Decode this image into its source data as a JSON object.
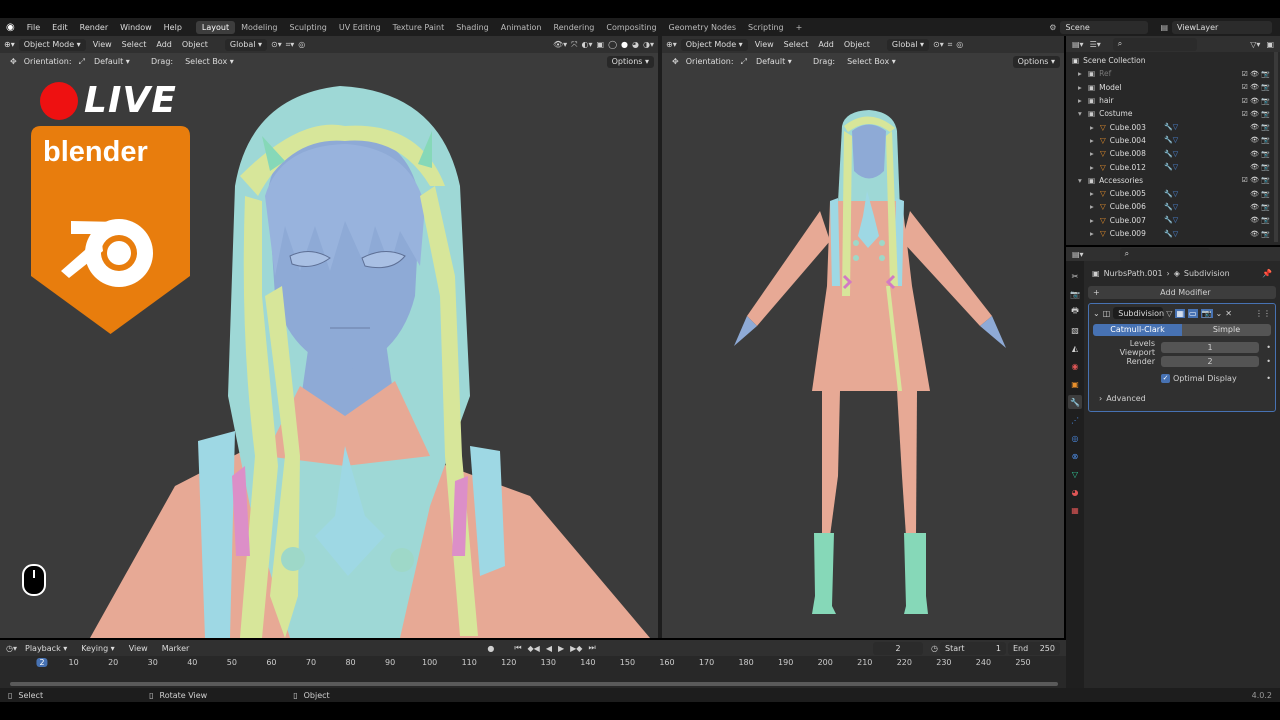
{
  "top_menu": [
    "File",
    "Edit",
    "Render",
    "Window",
    "Help"
  ],
  "workspaces": [
    {
      "label": "Layout",
      "active": true
    },
    {
      "label": "Modeling",
      "active": false
    },
    {
      "label": "Sculpting",
      "active": false
    },
    {
      "label": "UV Editing",
      "active": false
    },
    {
      "label": "Texture Paint",
      "active": false
    },
    {
      "label": "Shading",
      "active": false
    },
    {
      "label": "Animation",
      "active": false
    },
    {
      "label": "Rendering",
      "active": false
    },
    {
      "label": "Compositing",
      "active": false
    },
    {
      "label": "Geometry Nodes",
      "active": false
    },
    {
      "label": "Scripting",
      "active": false
    }
  ],
  "scene": "Scene",
  "view_layer": "ViewLayer",
  "viewport": {
    "mode": "Object Mode",
    "menus": [
      "View",
      "Select",
      "Add",
      "Object"
    ],
    "transform": "Global",
    "orientation_label": "Orientation:",
    "orientation_value": "Default",
    "drag_label": "Drag:",
    "drag_value": "Select Box",
    "options": "Options"
  },
  "overlay": {
    "live": "LIVE",
    "blender": "blender"
  },
  "outliner": {
    "root": "Scene Collection",
    "items": [
      {
        "label": "Ref",
        "indent": 0,
        "type": "collection",
        "dim": true
      },
      {
        "label": "Model",
        "indent": 0,
        "type": "collection"
      },
      {
        "label": "hair",
        "indent": 0,
        "type": "collection"
      },
      {
        "label": "Costume",
        "indent": 0,
        "type": "collection",
        "expanded": true
      },
      {
        "label": "Cube.003",
        "indent": 1,
        "type": "mesh"
      },
      {
        "label": "Cube.004",
        "indent": 1,
        "type": "mesh"
      },
      {
        "label": "Cube.008",
        "indent": 1,
        "type": "mesh"
      },
      {
        "label": "Cube.012",
        "indent": 1,
        "type": "mesh"
      },
      {
        "label": "Accessories",
        "indent": 0,
        "type": "collection",
        "expanded": true
      },
      {
        "label": "Cube.005",
        "indent": 1,
        "type": "mesh"
      },
      {
        "label": "Cube.006",
        "indent": 1,
        "type": "mesh"
      },
      {
        "label": "Cube.007",
        "indent": 1,
        "type": "mesh"
      },
      {
        "label": "Cube.009",
        "indent": 1,
        "type": "mesh"
      }
    ]
  },
  "properties": {
    "object": "NurbsPath.001",
    "modifier_crumb": "Subdivision",
    "add_modifier": "Add Modifier",
    "modifier_name": "Subdivision",
    "mode_catmull": "Catmull-Clark",
    "mode_simple": "Simple",
    "levels_viewport_label": "Levels Viewport",
    "levels_viewport": "1",
    "render_label": "Render",
    "render_value": "2",
    "optimal_display": "Optimal Display",
    "advanced": "Advanced"
  },
  "timeline": {
    "menus": [
      "Playback",
      "Keying",
      "View",
      "Marker"
    ],
    "current_frame": "2",
    "start_label": "Start",
    "start": "1",
    "end_label": "End",
    "end": "250",
    "ticks": [
      "2",
      "10",
      "20",
      "30",
      "40",
      "50",
      "60",
      "70",
      "80",
      "90",
      "100",
      "110",
      "120",
      "130",
      "140",
      "150",
      "160",
      "170",
      "180",
      "190",
      "200",
      "210",
      "220",
      "230",
      "240",
      "250"
    ]
  },
  "status": {
    "select": "Select",
    "rotate": "Rotate View",
    "object": "Object",
    "version": "4.0.2"
  },
  "colors": {
    "accent": "#4772b3",
    "skin": "#e7a995",
    "face": "#8eaad6",
    "hair_cyan": "#9ed8d6",
    "hair_yellow": "#d7e69a",
    "boots": "#86d8b8",
    "blender_orange": "#e87d0d"
  }
}
